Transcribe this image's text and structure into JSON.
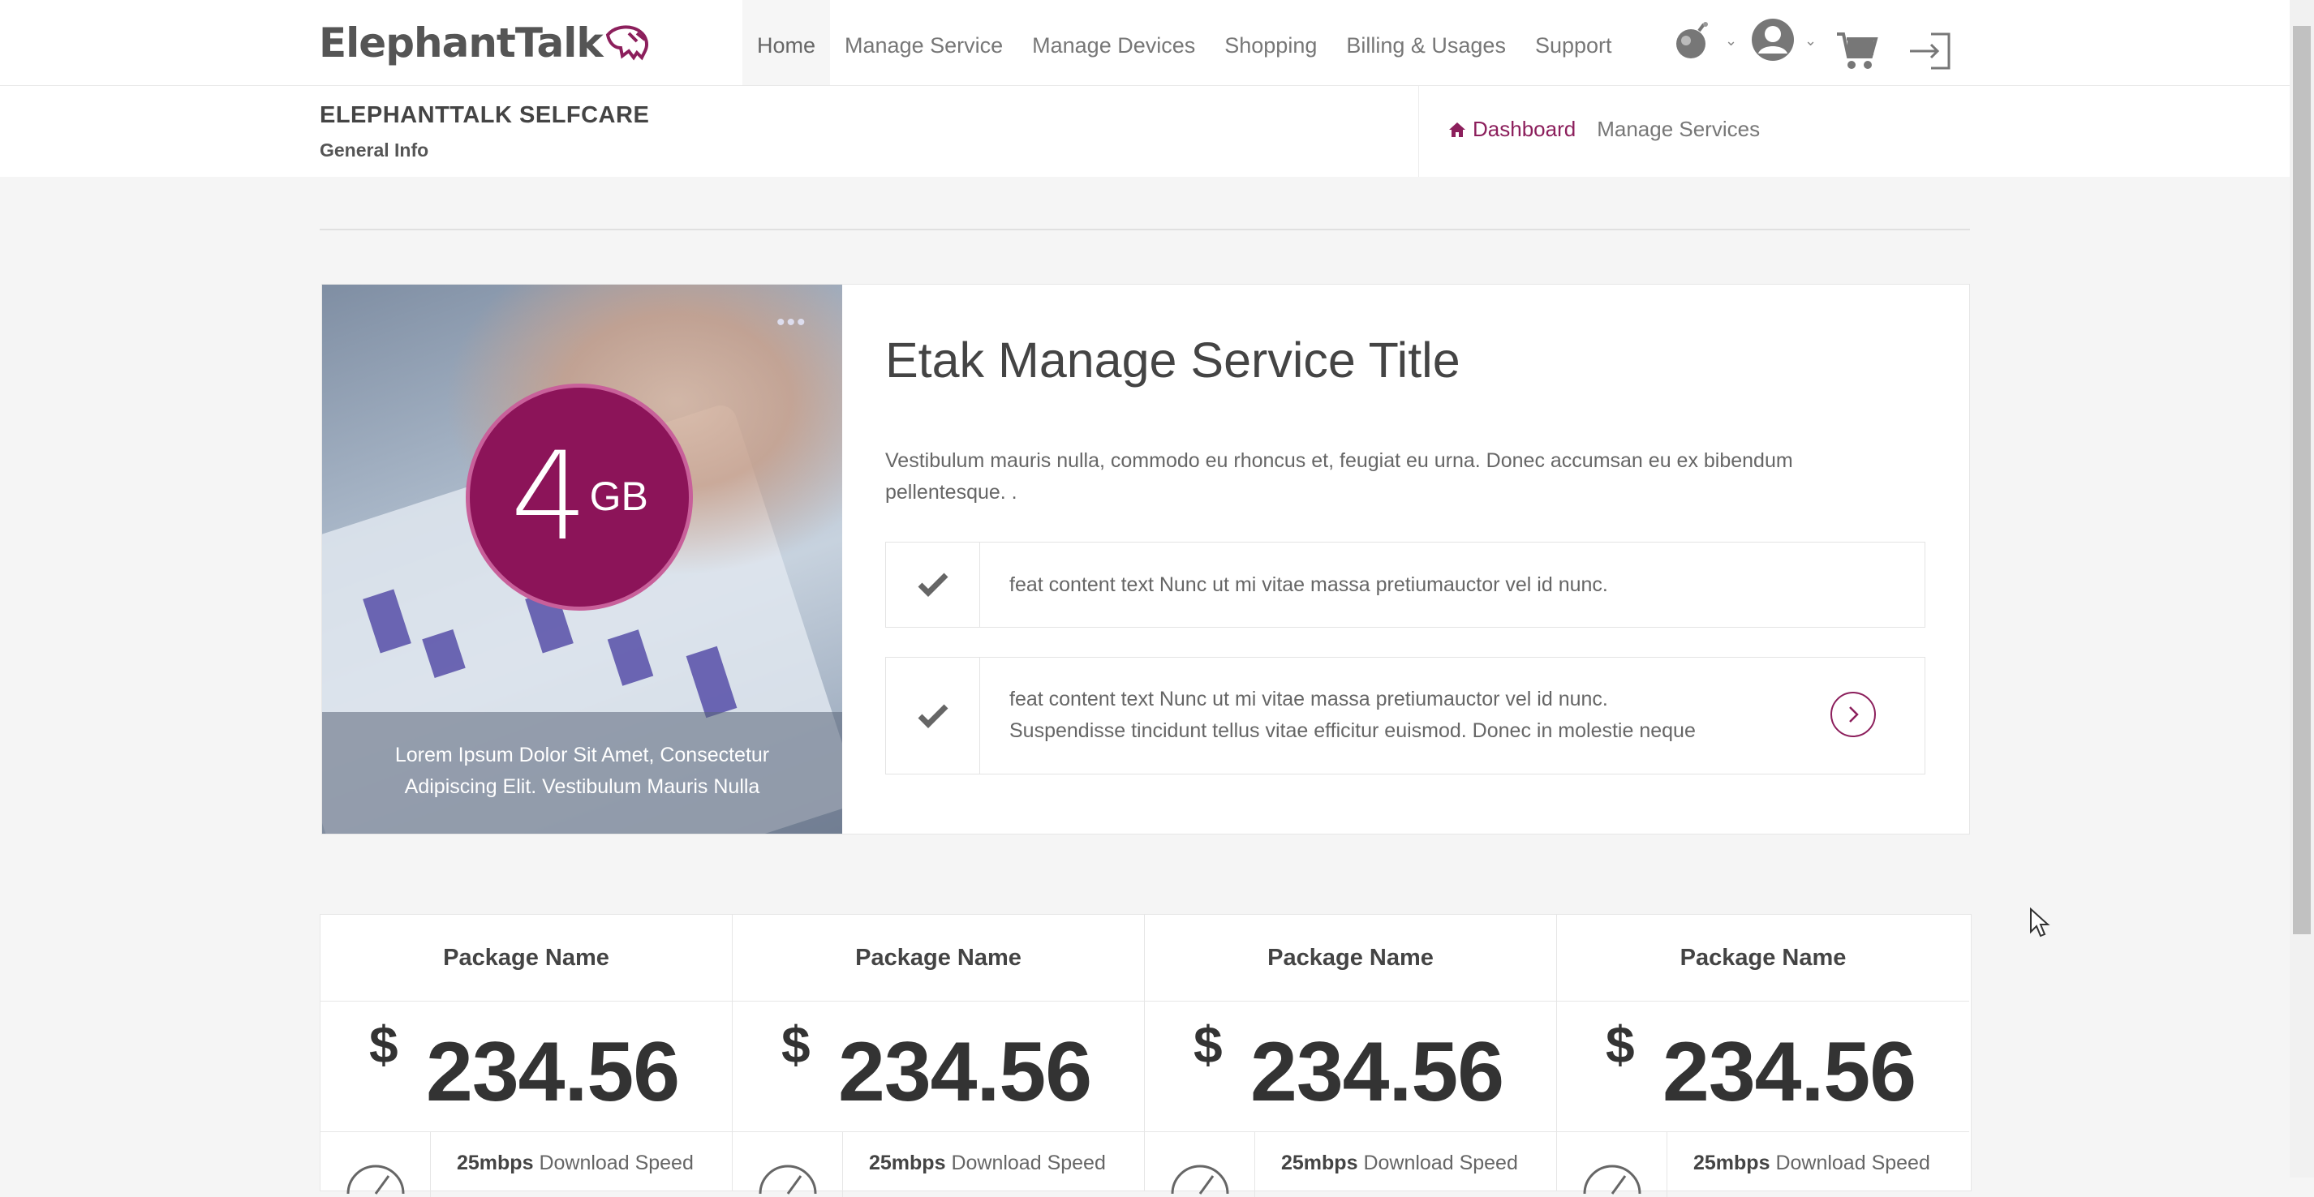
{
  "brand": {
    "logo_text": "ElephantTalk"
  },
  "nav": {
    "items": [
      {
        "label": "Home",
        "active": true
      },
      {
        "label": "Manage Service"
      },
      {
        "label": "Manage Devices"
      },
      {
        "label": "Shopping"
      },
      {
        "label": "Billing & Usages"
      },
      {
        "label": "Support"
      }
    ],
    "tools": [
      "bomb-icon",
      "user-avatar-icon",
      "shopping-cart-icon",
      "logout-icon"
    ]
  },
  "header": {
    "title": "ELEPHANTTALK SELFCARE",
    "subtitle": "General Info",
    "breadcrumb": {
      "home": "Dashboard",
      "current": "Manage Services"
    }
  },
  "hero": {
    "badge_value": "4",
    "badge_unit": "GB",
    "menu_dots": "•••",
    "caption_line1": "Lorem Ipsum Dolor Sit Amet, Consectetur",
    "caption_line2": "Adipiscing Elit. Vestibulum Mauris Nulla",
    "title": "Etak Manage Service Title",
    "description_line1": "Vestibulum mauris nulla, commodo eu rhoncus et, feugiat eu urna. Donec accumsan eu ex bibendum",
    "description_line2": "pellentesque. .",
    "features": [
      {
        "line1": "feat content text Nunc ut mi vitae massa pretiumauctor vel id nunc."
      },
      {
        "line1": "feat content text Nunc ut mi vitae massa pretiumauctor vel id nunc.",
        "line2": "Suspendisse tincidunt tellus vitae efficitur euismod. Donec in molestie neque"
      }
    ]
  },
  "packages": [
    {
      "name": "Package Name",
      "currency": "$",
      "price": "234.56",
      "speed": "25mbps",
      "speed_label": "Download Speed"
    },
    {
      "name": "Package Name",
      "currency": "$",
      "price": "234.56",
      "speed": "25mbps",
      "speed_label": "Download Speed"
    },
    {
      "name": "Package Name",
      "currency": "$",
      "price": "234.56",
      "speed": "25mbps",
      "speed_label": "Download Speed"
    },
    {
      "name": "Package Name",
      "currency": "$",
      "price": "234.56",
      "speed": "25mbps",
      "speed_label": "Download Speed"
    }
  ],
  "colors": {
    "accent": "#8c1f5c",
    "badge": "#8c1459"
  }
}
